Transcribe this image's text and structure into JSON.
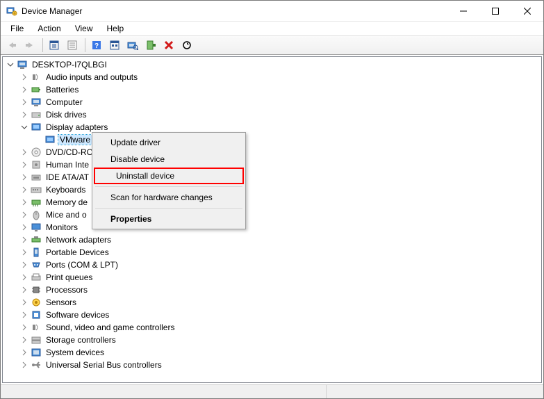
{
  "title": "Device Manager",
  "menu": [
    "File",
    "Action",
    "View",
    "Help"
  ],
  "toolbar": {
    "back": "back-icon",
    "forward": "forward-icon",
    "show_hidden": "show-hidden-icon",
    "properties": "properties-icon",
    "help": "help-icon",
    "options": "options-icon",
    "scan": "scan-icon",
    "add": "add-icon",
    "remove": "remove-icon",
    "update": "update-icon"
  },
  "tree": {
    "root": "DESKTOP-I7QLBGI",
    "items": [
      {
        "label": "Audio inputs and outputs",
        "expanded": false
      },
      {
        "label": "Batteries",
        "expanded": false
      },
      {
        "label": "Computer",
        "expanded": false
      },
      {
        "label": "Disk drives",
        "expanded": false
      },
      {
        "label": "Display adapters",
        "expanded": true,
        "children": [
          {
            "label": "VMware",
            "selected": true
          }
        ]
      },
      {
        "label": "DVD/CD-RO",
        "expanded": false
      },
      {
        "label": "Human Inte",
        "expanded": false
      },
      {
        "label": "IDE ATA/AT",
        "expanded": false
      },
      {
        "label": "Keyboards",
        "expanded": false
      },
      {
        "label": "Memory de",
        "expanded": false
      },
      {
        "label": "Mice and o",
        "expanded": false
      },
      {
        "label": "Monitors",
        "expanded": false
      },
      {
        "label": "Network adapters",
        "expanded": false
      },
      {
        "label": "Portable Devices",
        "expanded": false
      },
      {
        "label": "Ports (COM & LPT)",
        "expanded": false
      },
      {
        "label": "Print queues",
        "expanded": false
      },
      {
        "label": "Processors",
        "expanded": false
      },
      {
        "label": "Sensors",
        "expanded": false
      },
      {
        "label": "Software devices",
        "expanded": false
      },
      {
        "label": "Sound, video and game controllers",
        "expanded": false
      },
      {
        "label": "Storage controllers",
        "expanded": false
      },
      {
        "label": "System devices",
        "expanded": false
      },
      {
        "label": "Universal Serial Bus controllers",
        "expanded": false
      }
    ]
  },
  "context_menu": {
    "update": "Update driver",
    "disable": "Disable device",
    "uninstall": "Uninstall device",
    "scan": "Scan for hardware changes",
    "properties": "Properties"
  }
}
